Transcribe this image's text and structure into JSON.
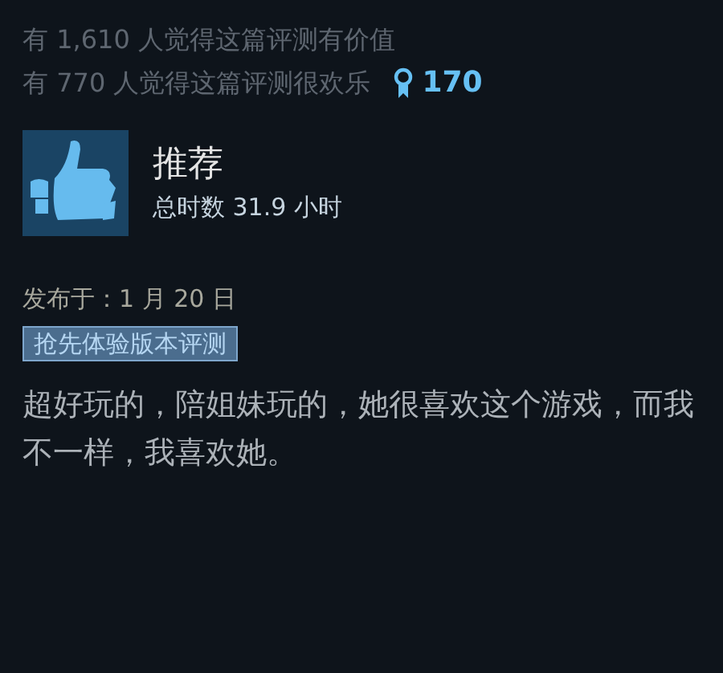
{
  "helpful_text": "有 1,610 人觉得这篇评测有价值",
  "funny_text": "有 770 人觉得这篇评测很欢乐",
  "award_count": "170",
  "verdict": "推荐",
  "playtime": "总时数 31.9 小时",
  "posted": "发布于：1 月 20 日",
  "tag": "抢先体验版本评测",
  "review_text": "超好玩的，陪姐妹玩的，她很喜欢这个游戏，而我不一样，我喜欢她。"
}
